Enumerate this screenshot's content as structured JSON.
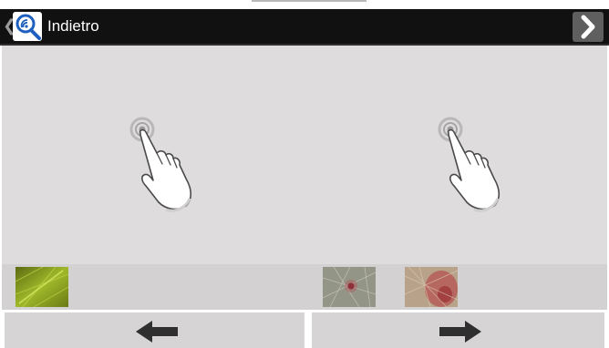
{
  "actionbar": {
    "title": "Indietro",
    "up_icon": "chevron-left-icon",
    "app_icon": "magnifier-nfc-icon",
    "next_icon": "arrow-right-icon"
  },
  "canvas": {
    "gestures": [
      {
        "icon": "tap-hand-icon"
      },
      {
        "icon": "tap-hand-icon"
      }
    ]
  },
  "thumbnails": [
    {
      "label": "leaf-texture"
    },
    {
      "label": "skin-red-spot"
    },
    {
      "label": "skin-redness"
    }
  ],
  "navigation": {
    "prev_icon": "arrow-left-icon",
    "next_icon": "arrow-right-icon"
  },
  "colors": {
    "actionbar": "#111111",
    "canvas": "#dedcdc",
    "strip": "#d3d1d1",
    "button": "#d6d4d4",
    "accent": "#1e5fbf"
  }
}
